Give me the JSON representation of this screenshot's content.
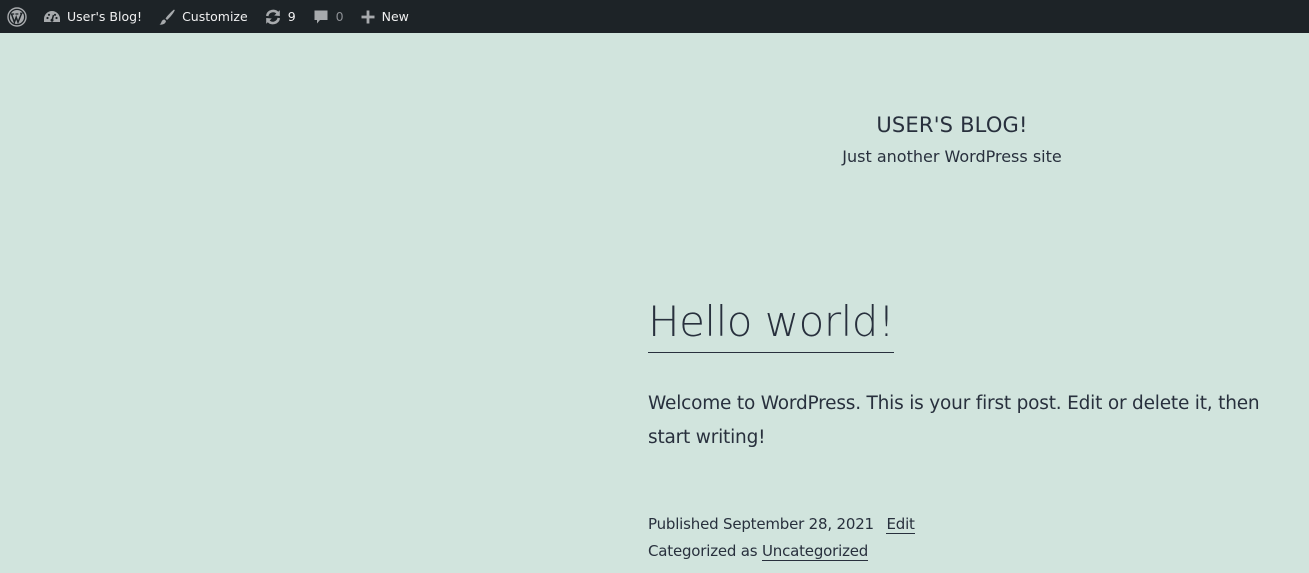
{
  "admin_bar": {
    "wp_logo_icon": "wordpress-logo-icon",
    "site_name": {
      "icon": "dashboard-icon",
      "label": "User's Blog!"
    },
    "customize": {
      "icon": "paintbrush-icon",
      "label": "Customize"
    },
    "updates": {
      "icon": "updates-icon",
      "count": "9"
    },
    "comments": {
      "icon": "comment-icon",
      "count": "0"
    },
    "new_content": {
      "icon": "plus-icon",
      "label": "New"
    }
  },
  "header": {
    "site_title": "USER'S BLOG!",
    "site_description": "Just another WordPress site"
  },
  "post": {
    "title": "Hello world!",
    "content": "Welcome to WordPress. This is your first post. Edit or delete it, then start writing!",
    "published_prefix": "Published",
    "published_date": "September 28, 2021",
    "edit_label": "Edit",
    "category_prefix": "Categorized as",
    "category": "Uncategorized"
  },
  "colors": {
    "admin_bar_bg": "#1d2327",
    "page_bg": "#d1e4dd",
    "text": "#28303d"
  }
}
